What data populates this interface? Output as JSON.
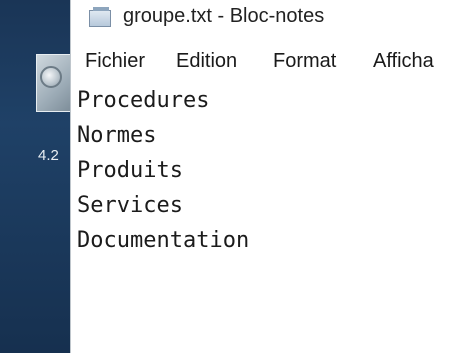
{
  "desktop": {
    "partial_text": "4.2"
  },
  "window": {
    "title": "groupe.txt - Bloc-notes",
    "icon": "notepad-icon"
  },
  "menu": {
    "items": [
      "Fichier",
      "Edition",
      "Format",
      "Afficha"
    ]
  },
  "editor": {
    "lines": [
      "Procedures",
      "Normes",
      "Produits",
      "Services",
      "Documentation"
    ]
  },
  "colors": {
    "desktop_background": "#1f4167",
    "window_background": "#ffffff",
    "text": "#1b1b1b"
  }
}
